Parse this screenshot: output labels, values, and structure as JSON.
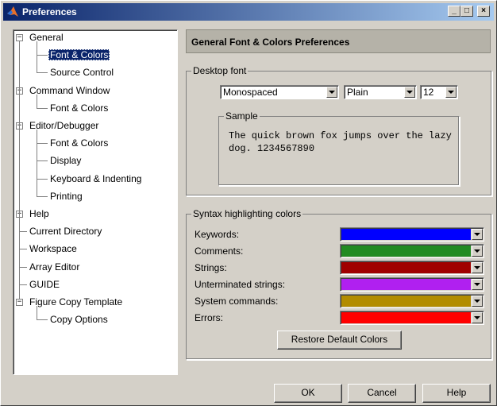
{
  "window": {
    "title": "Preferences",
    "buttons": {
      "minimize": "_",
      "maximize": "□",
      "close": "×"
    }
  },
  "tree": {
    "items": [
      {
        "label": "General",
        "level": 0,
        "expander": "−"
      },
      {
        "label": "Font & Colors",
        "level": 1,
        "selected": true
      },
      {
        "label": "Source Control",
        "level": 1
      },
      {
        "label": "Command Window",
        "level": 0,
        "expander": "−"
      },
      {
        "label": "Font & Colors",
        "level": 1
      },
      {
        "label": "Editor/Debugger",
        "level": 0,
        "expander": "−"
      },
      {
        "label": "Font & Colors",
        "level": 1
      },
      {
        "label": "Display",
        "level": 1
      },
      {
        "label": "Keyboard & Indenting",
        "level": 1
      },
      {
        "label": "Printing",
        "level": 1
      },
      {
        "label": "Help",
        "level": 0,
        "expander": "+"
      },
      {
        "label": "Current Directory",
        "level": 0
      },
      {
        "label": "Workspace",
        "level": 0
      },
      {
        "label": "Array Editor",
        "level": 0
      },
      {
        "label": "GUIDE",
        "level": 0
      },
      {
        "label": "Figure Copy Template",
        "level": 0,
        "expander": "−"
      },
      {
        "label": "Copy Options",
        "level": 1
      }
    ]
  },
  "panel": {
    "header": "General Font & Colors Preferences",
    "desktop_font": {
      "group_label": "Desktop font",
      "font_name": "Monospaced",
      "font_style": "Plain",
      "font_size": "12",
      "sample_label": "Sample",
      "sample_text": "The quick brown fox jumps over the lazy dog. 1234567890"
    },
    "syntax": {
      "group_label": "Syntax highlighting colors",
      "rows": [
        {
          "label": "Keywords:",
          "color": "#0000ff"
        },
        {
          "label": "Comments:",
          "color": "#228b22"
        },
        {
          "label": "Strings:",
          "color": "#a00000"
        },
        {
          "label": "Unterminated strings:",
          "color": "#b020f0"
        },
        {
          "label": "System commands:",
          "color": "#b28c00"
        },
        {
          "label": "Errors:",
          "color": "#ff0000"
        }
      ],
      "restore_button": "Restore Default Colors"
    }
  },
  "footer": {
    "ok": "OK",
    "cancel": "Cancel",
    "help": "Help"
  }
}
